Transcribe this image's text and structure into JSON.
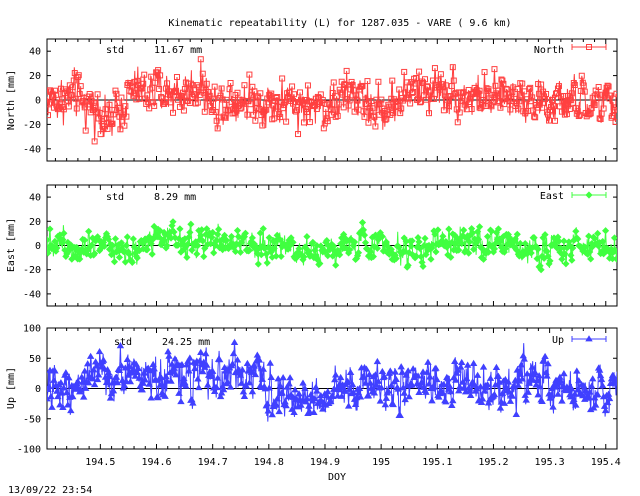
{
  "title": "Kinematic repeatability (L) for 1287.035 - VARE  (  9.6 km)",
  "xlabel": "DOY",
  "footer": "13/09/22 23:54",
  "std_label": "std",
  "x_ticks": [
    "194.5",
    "194.6",
    "194.7",
    "194.8",
    "194.9",
    "195",
    "195.1",
    "195.2",
    "195.3",
    "195.4"
  ],
  "chart_data": [
    {
      "type": "line",
      "series": [
        {
          "name": "North",
          "color": "#ff4040",
          "marker": "square"
        }
      ],
      "ylabel": "North [mm]",
      "std": "11.67 mm",
      "xlim": [
        194.405,
        195.42
      ],
      "ylim": [
        -50,
        50
      ],
      "y_ticks": [
        "40",
        "20",
        "0",
        "-20",
        "-40"
      ],
      "noise_amplitude_mm": 12,
      "wander": [
        [
          194.405,
          0
        ],
        [
          194.45,
          2
        ],
        [
          194.5,
          -8
        ],
        [
          194.52,
          -20
        ],
        [
          194.55,
          5
        ],
        [
          194.6,
          8
        ],
        [
          194.65,
          5
        ],
        [
          194.68,
          15
        ],
        [
          194.7,
          -5
        ],
        [
          194.73,
          3
        ],
        [
          194.8,
          -2
        ],
        [
          194.9,
          -5
        ],
        [
          194.95,
          5
        ],
        [
          195.0,
          -10
        ],
        [
          195.05,
          8
        ],
        [
          195.1,
          10
        ],
        [
          195.15,
          3
        ],
        [
          195.2,
          0
        ],
        [
          195.25,
          5
        ],
        [
          195.3,
          -5
        ],
        [
          195.35,
          0
        ],
        [
          195.4,
          -5
        ],
        [
          195.42,
          -5
        ]
      ]
    },
    {
      "type": "line",
      "series": [
        {
          "name": "East",
          "color": "#40ff40",
          "marker": "diamond"
        }
      ],
      "ylabel": "East [mm]",
      "std": "8.29 mm",
      "xlim": [
        194.405,
        195.42
      ],
      "ylim": [
        -50,
        50
      ],
      "y_ticks": [
        "40",
        "20",
        "0",
        "-20",
        "-40"
      ],
      "noise_amplitude_mm": 8,
      "wander": [
        [
          194.405,
          5
        ],
        [
          194.45,
          0
        ],
        [
          194.5,
          5
        ],
        [
          194.55,
          -3
        ],
        [
          194.6,
          5
        ],
        [
          194.65,
          0
        ],
        [
          194.7,
          3
        ],
        [
          194.8,
          0
        ],
        [
          194.9,
          -3
        ],
        [
          195.0,
          3
        ],
        [
          195.05,
          -5
        ],
        [
          195.1,
          0
        ],
        [
          195.2,
          2
        ],
        [
          195.3,
          -3
        ],
        [
          195.35,
          2
        ],
        [
          195.42,
          -5
        ]
      ]
    },
    {
      "type": "line",
      "series": [
        {
          "name": "Up",
          "color": "#4040ff",
          "marker": "triangle"
        }
      ],
      "ylabel": "Up [mm]",
      "std": "24.25 mm",
      "xlim": [
        194.405,
        195.42
      ],
      "ylim": [
        -100,
        100
      ],
      "y_ticks": [
        "100",
        "50",
        "0",
        "-50",
        "-100"
      ],
      "noise_amplitude_mm": 24,
      "wander": [
        [
          194.405,
          -10
        ],
        [
          194.45,
          10
        ],
        [
          194.5,
          20
        ],
        [
          194.55,
          25
        ],
        [
          194.6,
          20
        ],
        [
          194.7,
          15
        ],
        [
          194.75,
          30
        ],
        [
          194.8,
          0
        ],
        [
          194.85,
          -20
        ],
        [
          194.9,
          -10
        ],
        [
          194.95,
          0
        ],
        [
          195.0,
          10
        ],
        [
          195.05,
          0
        ],
        [
          195.1,
          5
        ],
        [
          195.15,
          15
        ],
        [
          195.2,
          -10
        ],
        [
          195.25,
          20
        ],
        [
          195.3,
          10
        ],
        [
          195.35,
          -5
        ],
        [
          195.42,
          -5
        ]
      ]
    }
  ]
}
